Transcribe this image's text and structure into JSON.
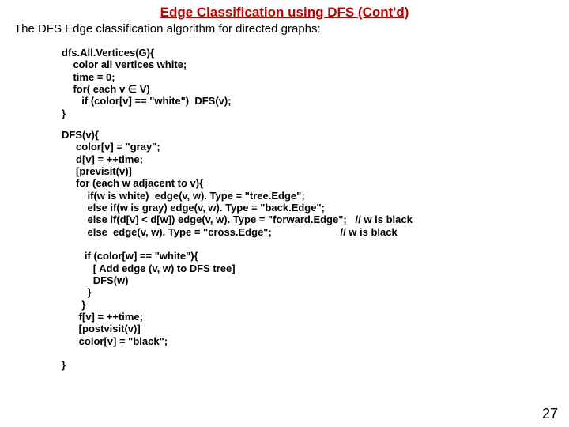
{
  "slide": {
    "title": "Edge Classification using DFS (Cont'd)",
    "subtitle": "The DFS Edge classification algorithm for directed graphs:",
    "code1": "dfs.All.Vertices(G){\n    color all vertices white;\n    time = 0;\n    for( each v ∈ V)\n       if (color[v] == \"white\")  DFS(v);\n}",
    "code2": "DFS(v){\n     color[v] = \"gray\";\n     d[v] = ++time;\n     [previsit(v)]\n     for (each w adjacent to v){\n         if(w is white)  edge(v, w). Type = \"tree.Edge\";\n         else if(w is gray) edge(v, w). Type = \"back.Edge\";\n         else if(d[v] < d[w]) edge(v, w). Type = \"forward.Edge\";   // w is black\n         else  edge(v, w). Type = \"cross.Edge\";                        // w is black\n\n        if (color[w] == \"white\"){\n           [ Add edge (v, w) to DFS tree]\n           DFS(w)\n         }\n       }\n      f[v] = ++time;\n      [postvisit(v)]\n      color[v] = \"black\";\n\n}",
    "page_number": "27"
  }
}
